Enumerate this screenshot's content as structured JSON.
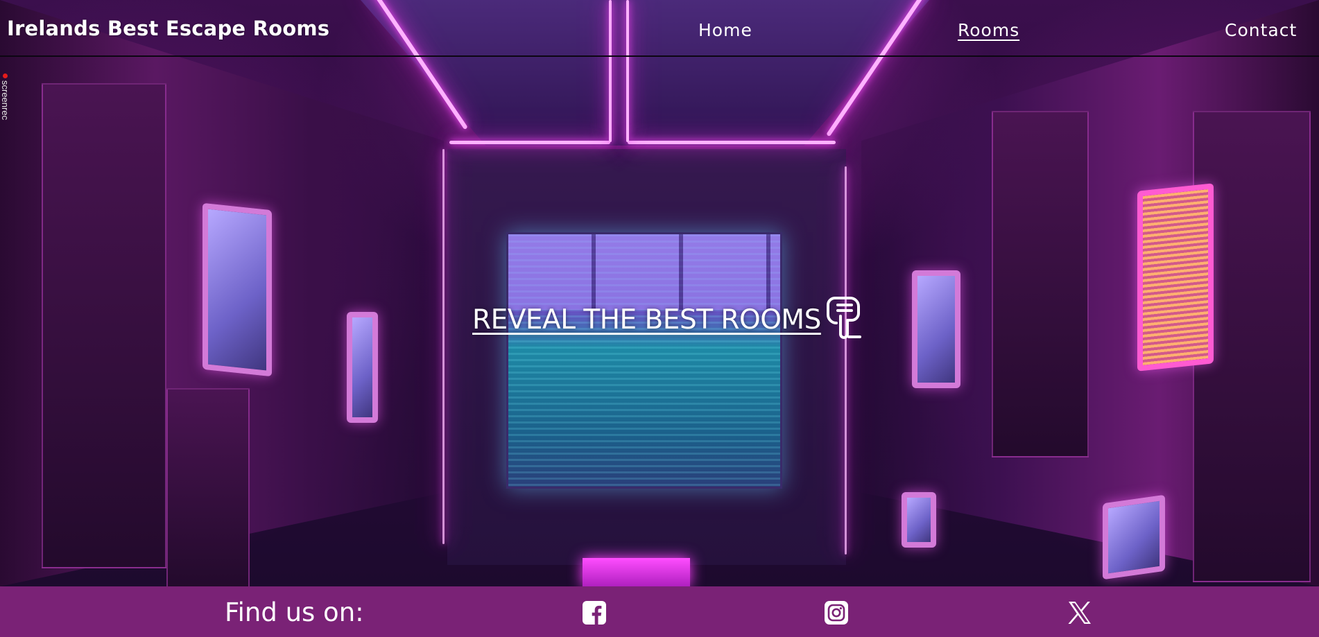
{
  "header": {
    "brand": "Irelands Best Escape Rooms",
    "nav": {
      "home": "Home",
      "rooms": "Rooms",
      "contact": "Contact"
    },
    "active_item": "Rooms"
  },
  "watermark": {
    "text": "screenrec"
  },
  "hero": {
    "cta_label": "REVEAL THE BEST ROOMS",
    "cta_icon": "hand-pointing-down-icon"
  },
  "footer": {
    "label": "Find us on:",
    "social": [
      {
        "name": "facebook",
        "icon": "facebook-icon"
      },
      {
        "name": "instagram",
        "icon": "instagram-icon"
      },
      {
        "name": "x",
        "icon": "x-icon"
      }
    ]
  },
  "colors": {
    "footer_bg": "#7a2276",
    "text": "#ffffff",
    "neon": "#ff4dff"
  }
}
